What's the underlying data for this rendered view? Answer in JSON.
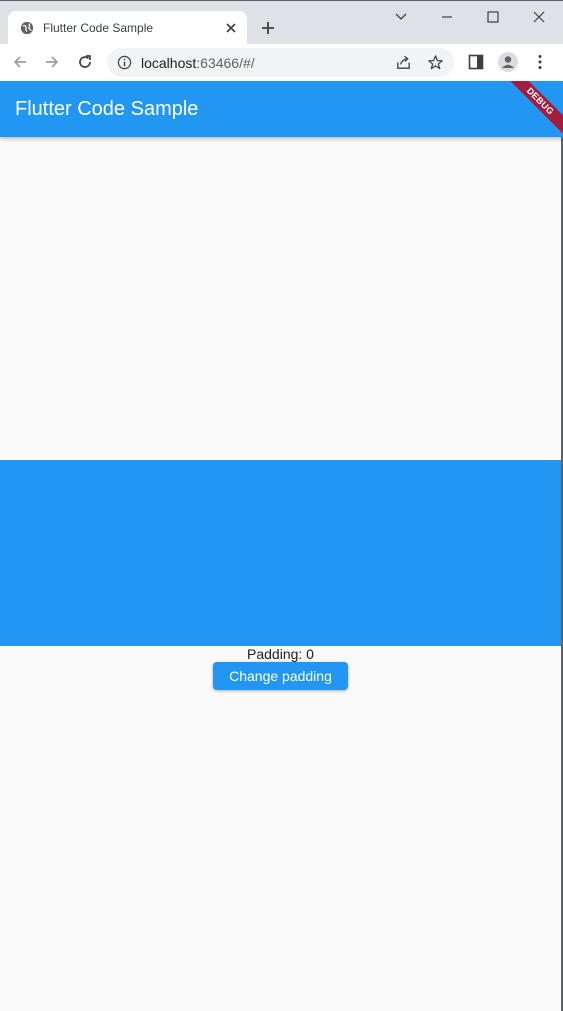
{
  "browser": {
    "tab": {
      "title": "Flutter Code Sample"
    },
    "address": {
      "host": "localhost",
      "rest": ":63466/#/"
    }
  },
  "app": {
    "title": "Flutter Code Sample",
    "debug_banner": "DEBUG",
    "padding_label": "Padding: 0",
    "button_label": "Change padding"
  },
  "colors": {
    "primary": "#2196f3",
    "background": "#fafafa",
    "debug_banner": "#a51d3c"
  },
  "icons": {
    "tab": [
      "globe-icon",
      "close-icon"
    ],
    "window": [
      "chevron-down-icon",
      "minimize-icon",
      "maximize-icon",
      "window-close-icon"
    ],
    "nav": [
      "back-icon",
      "forward-icon",
      "reload-icon"
    ],
    "omnibox": [
      "info-icon",
      "share-icon",
      "star-icon"
    ],
    "toolbar": [
      "side-panel-icon",
      "profile-icon",
      "more-icon"
    ]
  }
}
